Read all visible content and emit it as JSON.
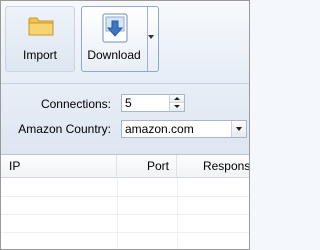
{
  "toolbar": {
    "import_label": "Import",
    "download_label": "Download"
  },
  "settings": {
    "connections_label": "Connections:",
    "connections_value": "5",
    "country_label": "Amazon Country:",
    "country_value": "amazon.com"
  },
  "table": {
    "columns": [
      "IP",
      "Port",
      "Response"
    ],
    "rows": []
  },
  "colors": {
    "ribbon_bg": "#e6edf6",
    "settings_bg": "#dde6f1",
    "folder_yellow": "#f2c14e",
    "download_blue": "#3b78c2"
  },
  "icons": [
    "folder-icon",
    "download-icon",
    "chevron-down-icon"
  ]
}
